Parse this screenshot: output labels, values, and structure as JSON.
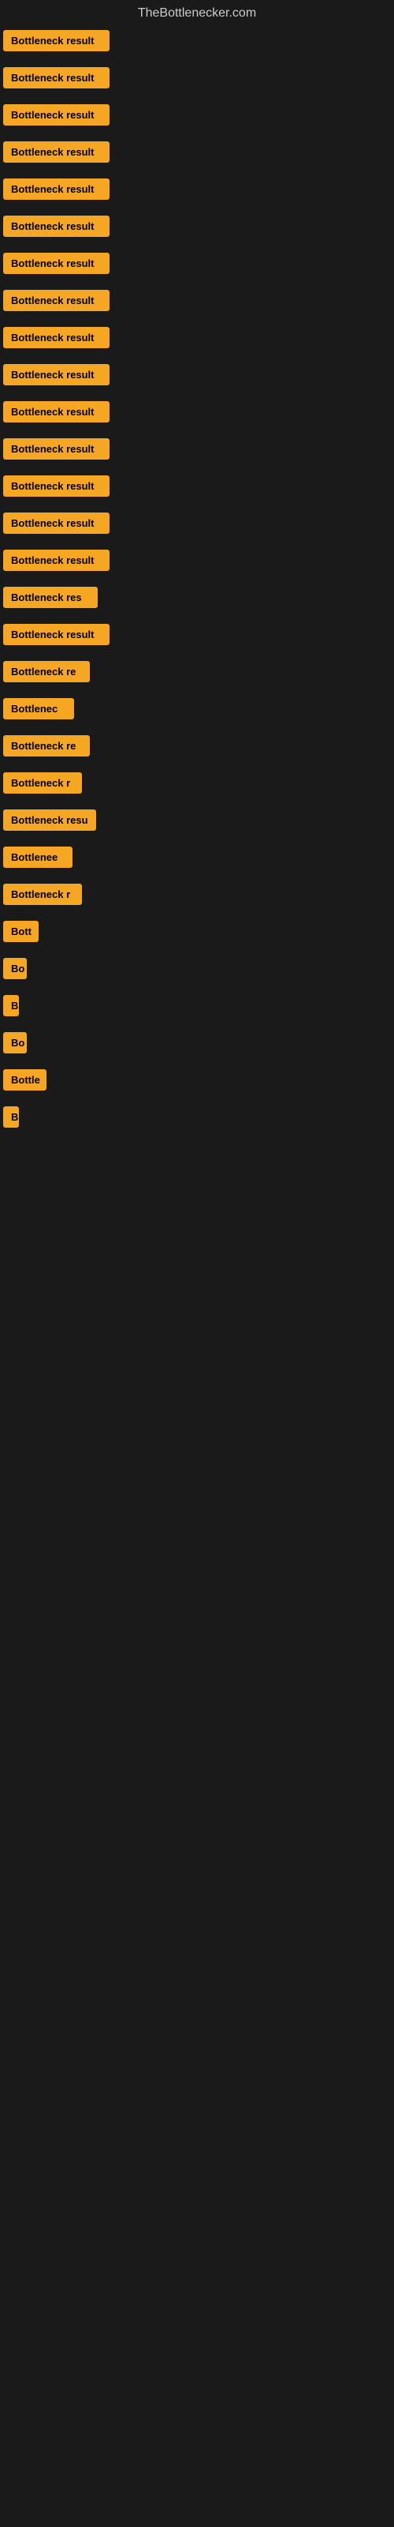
{
  "site": {
    "title": "TheBottlenecker.com"
  },
  "rows": [
    {
      "id": 1,
      "label": "Bottleneck result",
      "width": 135
    },
    {
      "id": 2,
      "label": "Bottleneck result",
      "width": 135
    },
    {
      "id": 3,
      "label": "Bottleneck result",
      "width": 135
    },
    {
      "id": 4,
      "label": "Bottleneck result",
      "width": 135
    },
    {
      "id": 5,
      "label": "Bottleneck result",
      "width": 135
    },
    {
      "id": 6,
      "label": "Bottleneck result",
      "width": 135
    },
    {
      "id": 7,
      "label": "Bottleneck result",
      "width": 135
    },
    {
      "id": 8,
      "label": "Bottleneck result",
      "width": 135
    },
    {
      "id": 9,
      "label": "Bottleneck result",
      "width": 135
    },
    {
      "id": 10,
      "label": "Bottleneck result",
      "width": 135
    },
    {
      "id": 11,
      "label": "Bottleneck result",
      "width": 135
    },
    {
      "id": 12,
      "label": "Bottleneck result",
      "width": 135
    },
    {
      "id": 13,
      "label": "Bottleneck result",
      "width": 135
    },
    {
      "id": 14,
      "label": "Bottleneck result",
      "width": 135
    },
    {
      "id": 15,
      "label": "Bottleneck result",
      "width": 135
    },
    {
      "id": 16,
      "label": "Bottleneck res",
      "width": 120
    },
    {
      "id": 17,
      "label": "Bottleneck result",
      "width": 135
    },
    {
      "id": 18,
      "label": "Bottleneck re",
      "width": 110
    },
    {
      "id": 19,
      "label": "Bottlenec",
      "width": 90
    },
    {
      "id": 20,
      "label": "Bottleneck re",
      "width": 110
    },
    {
      "id": 21,
      "label": "Bottleneck r",
      "width": 100
    },
    {
      "id": 22,
      "label": "Bottleneck resu",
      "width": 118
    },
    {
      "id": 23,
      "label": "Bottlenee",
      "width": 88
    },
    {
      "id": 24,
      "label": "Bottleneck r",
      "width": 100
    },
    {
      "id": 25,
      "label": "Bott",
      "width": 45
    },
    {
      "id": 26,
      "label": "Bo",
      "width": 30
    },
    {
      "id": 27,
      "label": "B",
      "width": 16
    },
    {
      "id": 28,
      "label": "Bo",
      "width": 30
    },
    {
      "id": 29,
      "label": "Bottle",
      "width": 55
    },
    {
      "id": 30,
      "label": "B",
      "width": 16
    }
  ]
}
